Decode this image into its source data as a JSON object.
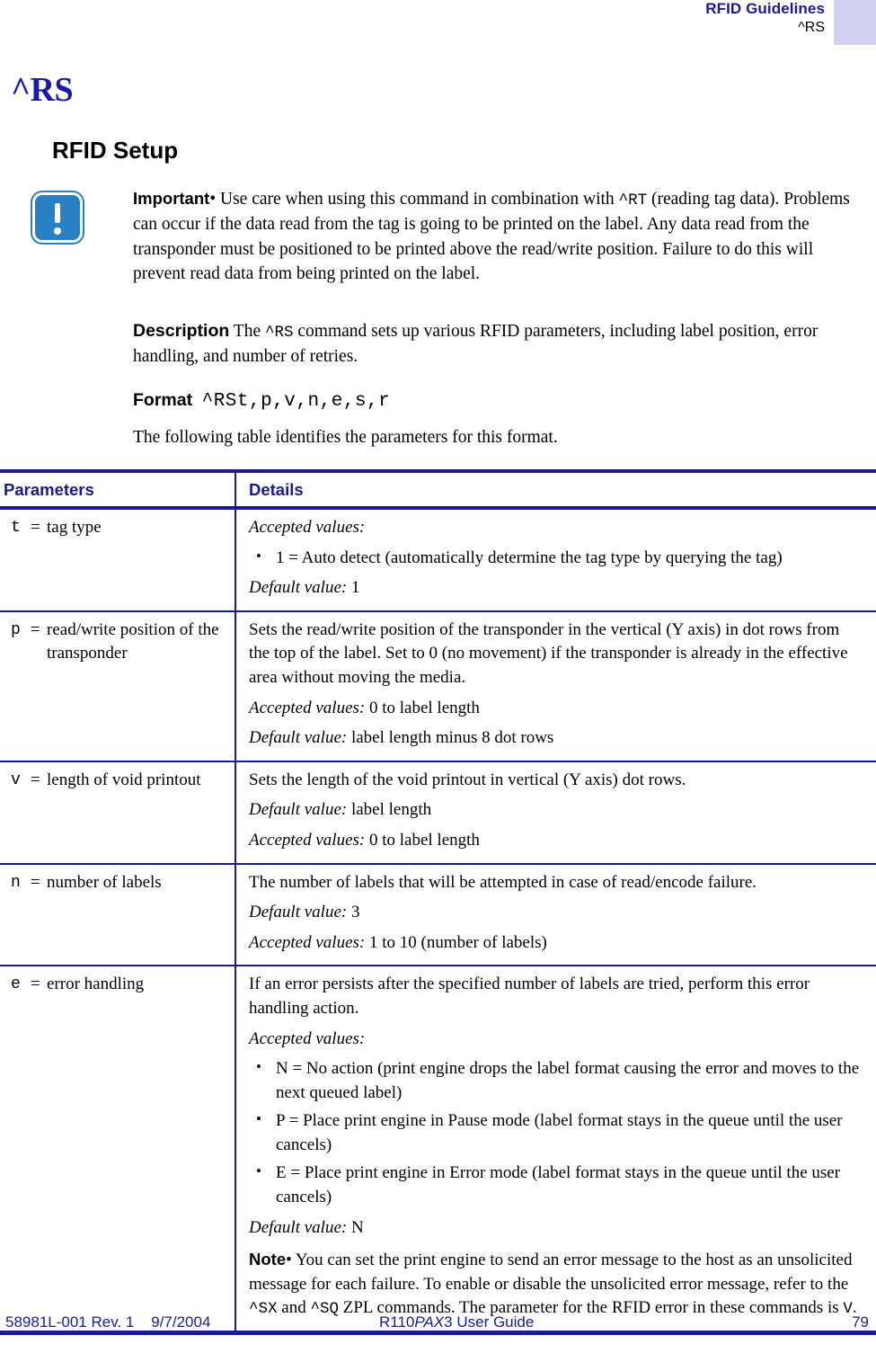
{
  "header": {
    "title": "RFID Guidelines",
    "subtitle": "^RS",
    "corner_block_color": "#d2d2f0",
    "title_color": "#1a1a96"
  },
  "command_heading": "^RS",
  "section_heading": "RFID Setup",
  "callout": {
    "icon": "important-exclamation-icon",
    "icon_color": "#2980c4",
    "label": "Important",
    "separator": "•",
    "text_part1": " Use care when using this command in combination with ",
    "code1": "^RT",
    "text_part2": " (reading tag data). Problems can occur if the data read from the tag is going to be printed on the label. Any data read from the transponder must be positioned to be printed above the read/write position. Failure to do this will prevent read data from being printed on the label."
  },
  "description": {
    "label": "Description",
    "text_part1": "  The ",
    "code1": "^RS",
    "text_part2": " command sets up various RFID parameters, including label position, error handling, and number of retries."
  },
  "format": {
    "label": "Format",
    "code": "^RSt,p,v,n,e,s,r"
  },
  "table_intro": "The following table identifies the parameters for this format.",
  "table": {
    "headers": {
      "parameters": "Parameters",
      "details": "Details"
    },
    "border_color": "#1a1a96",
    "rows": [
      {
        "letter": "t",
        "eq": "=",
        "name": "tag type",
        "details": {
          "accepted_label": "Accepted values:",
          "bullets": [
            "1 = Auto detect (automatically determine the tag type by querying the tag)"
          ],
          "default_label": "Default value:",
          "default_value": " 1"
        }
      },
      {
        "letter": "p",
        "eq": "=",
        "name": "read/write position of the transponder",
        "details": {
          "paragraph": "Sets the read/write position of the transponder in the vertical (Y axis) in dot rows from the top of the label. Set to 0 (no movement) if the transponder is already in the effective area without moving the media.",
          "accepted_label": "Accepted values:",
          "accepted_value": " 0 to label length",
          "default_label": "Default value:",
          "default_value": " label length minus 8 dot rows"
        }
      },
      {
        "letter": "v",
        "eq": "=",
        "name": "length of void printout",
        "details": {
          "paragraph": "Sets the length of the void printout in vertical (Y axis) dot rows.",
          "default_label": "Default value:",
          "default_value": " label length",
          "accepted_label": "Accepted values:",
          "accepted_value": " 0 to label length"
        }
      },
      {
        "letter": "n",
        "eq": "=",
        "name": "number of labels",
        "details": {
          "paragraph": "The number of labels that will be attempted in case of read/encode failure.",
          "default_label": "Default value:",
          "default_value": " 3",
          "accepted_label": "Accepted values:",
          "accepted_value": " 1 to 10 (number of labels)"
        }
      },
      {
        "letter": "e",
        "eq": "=",
        "name": "error handling",
        "details": {
          "paragraph": "If an error persists after the specified number of labels are tried, perform this error handling action.",
          "accepted_label": "Accepted values:",
          "bullets": [
            "N = No action (print engine drops the label format causing the error and moves to the next queued label)",
            "P = Place print engine in Pause mode (label format stays in the queue until the user cancels)",
            "E = Place print engine in Error mode (label format stays in the queue until the user cancels)"
          ],
          "default_label": "Default value:",
          "default_value": " N",
          "note": {
            "label": "Note",
            "separator": "•",
            "text_part1": " You can set the print engine to send an error message to the host as an unsolicited message for each failure. To enable or disable the unsolicited error message, refer to the ",
            "code1": "^SX",
            "text_part2": " and ",
            "code2": "^SQ",
            "text_part3": " ZPL commands. The parameter for the RFID error in these commands is ",
            "code3": "V",
            "text_part4": "."
          }
        }
      }
    ]
  },
  "footer": {
    "left": "58981L-001 Rev. 1    9/7/2004",
    "center_pre": "R110",
    "center_italic": "PAX",
    "center_post": "3 User Guide",
    "page_number": "79",
    "color": "#1a1a96"
  }
}
